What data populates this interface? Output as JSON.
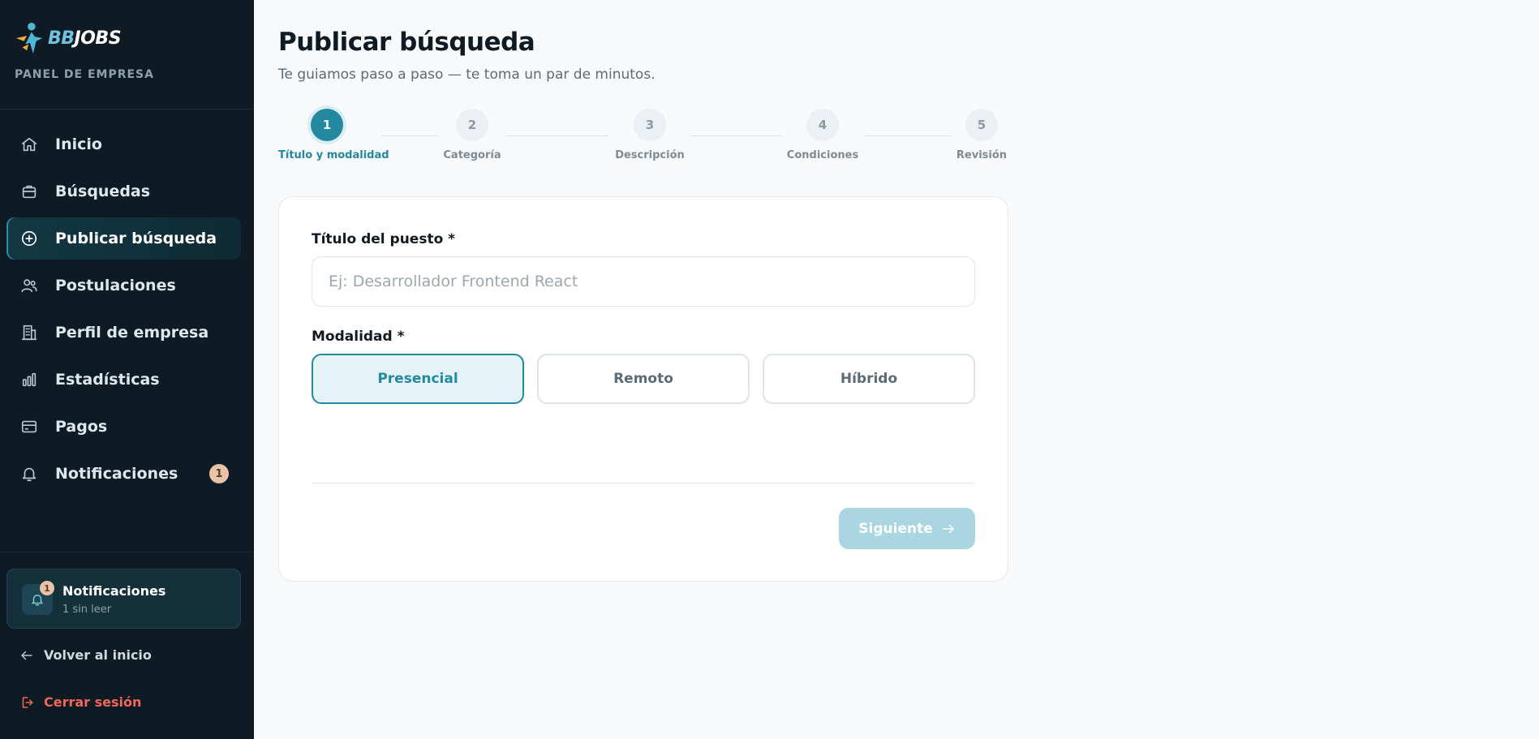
{
  "brand": {
    "bb": "BB",
    "jobs": "JOBS",
    "panel_label": "PANEL DE EMPRESA"
  },
  "sidebar": {
    "items": [
      {
        "label": "Inicio",
        "icon": "home-icon"
      },
      {
        "label": "Búsquedas",
        "icon": "briefcase-icon"
      },
      {
        "label": "Publicar búsqueda",
        "icon": "plus-circle-icon",
        "active": true
      },
      {
        "label": "Postulaciones",
        "icon": "users-icon"
      },
      {
        "label": "Perfil de empresa",
        "icon": "building-icon"
      },
      {
        "label": "Estadísticas",
        "icon": "bar-chart-icon"
      },
      {
        "label": "Pagos",
        "icon": "credit-card-icon"
      },
      {
        "label": "Notificaciones",
        "icon": "bell-icon",
        "badge": "1"
      }
    ],
    "notif_card": {
      "badge": "1",
      "title": "Notificaciones",
      "subtitle": "1 sin leer"
    },
    "back_label": "Volver al inicio",
    "logout_label": "Cerrar sesión"
  },
  "main": {
    "title": "Publicar búsqueda",
    "subtitle": "Te guiamos paso a paso — te toma un par de minutos.",
    "steps": [
      {
        "number": "1",
        "label": "Título y modalidad",
        "active": true
      },
      {
        "number": "2",
        "label": "Categoría"
      },
      {
        "number": "3",
        "label": "Descripción"
      },
      {
        "number": "4",
        "label": "Condiciones"
      },
      {
        "number": "5",
        "label": "Revisión"
      }
    ],
    "form": {
      "title_label": "Título del puesto *",
      "title_placeholder": "Ej: Desarrollador Frontend React",
      "title_value": "",
      "mode_label": "Modalidad *",
      "modes": [
        "Presencial",
        "Remoto",
        "Híbrido"
      ],
      "selected_mode": "Presencial",
      "next_label": "Siguiente"
    }
  },
  "colors": {
    "sidebar_bg": "#0e1b24",
    "accent": "#2388a0",
    "danger": "#f2675a",
    "badge": "#e8c3a7",
    "next_disabled": "#a9d6e0"
  }
}
